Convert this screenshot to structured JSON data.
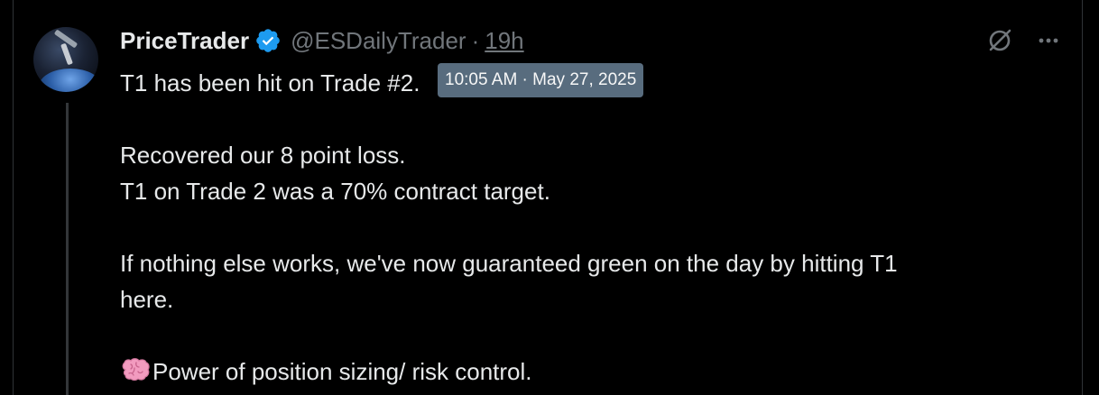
{
  "tweet": {
    "display_name": "PriceTrader",
    "handle": "@ESDailyTrader",
    "separator": "·",
    "relative_time": "19h",
    "tooltip_time": "10:05 AM · May 27, 2025",
    "lines": {
      "l1": "T1 has been hit on Trade #2.",
      "l2": "Recovered our 8 point loss.",
      "l3": "T1 on Trade 2 was a 70% contract target.",
      "l4": "If nothing else works, we've now guaranteed green on the day by hitting T1",
      "l5": "here.",
      "l6": "Power of position sizing/ risk control."
    }
  },
  "icons": {
    "verified": "verified-badge-icon",
    "grok": "grok-icon",
    "more": "more-options-icon",
    "brain": "brain-emoji-icon"
  },
  "colors": {
    "background": "#000000",
    "text": "#e7e9ea",
    "secondary": "#71767b",
    "verified": "#1d9bf0",
    "tooltip": "#5b7083"
  }
}
